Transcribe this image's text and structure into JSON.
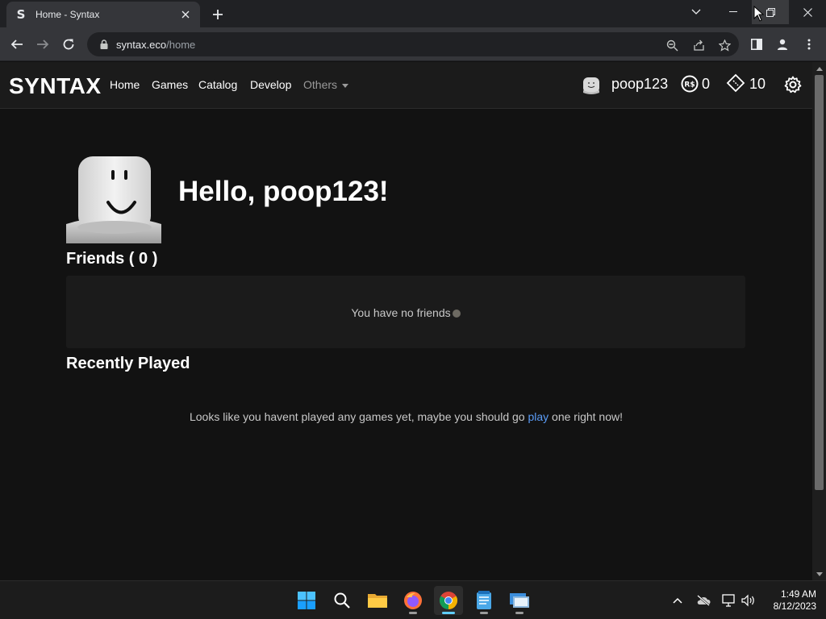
{
  "browser": {
    "tab_title": "Home - Syntax",
    "tab_favicon": "S",
    "url_host": "syntax.eco",
    "url_path": "/home"
  },
  "site": {
    "brand": "SYNTAX",
    "nav": {
      "home": "Home",
      "games": "Games",
      "catalog": "Catalog",
      "develop": "Develop",
      "others": "Others"
    },
    "username": "poop123",
    "robux": "0",
    "tickets": "10"
  },
  "main": {
    "greeting": "Hello, poop123!",
    "friends_title": "Friends ( 0 )",
    "friends_empty": "You have no friends",
    "recent_title": "Recently Played",
    "recent_empty_before": "Looks like you havent played any games yet, maybe you should go ",
    "recent_empty_link": "play",
    "recent_empty_after": " one right now!"
  },
  "taskbar": {
    "time": "1:49 AM",
    "date": "8/12/2023"
  },
  "colors": {
    "link": "#5b9cf6",
    "accent": "#60cdff"
  }
}
